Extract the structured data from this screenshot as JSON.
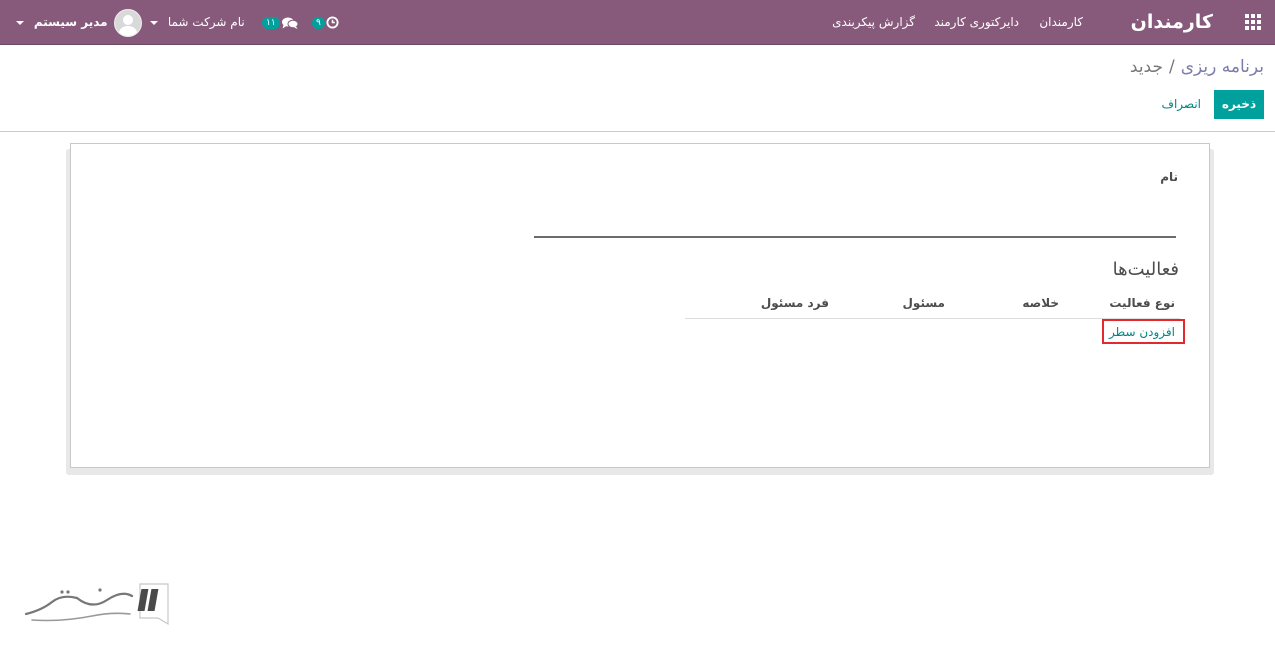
{
  "navbar": {
    "brand": "کارمندان",
    "menu": [
      "کارمندان",
      "دایرکتوری کارمند",
      "گزارش",
      "پیکربندی"
    ],
    "activity_badge": "۹",
    "messages_badge": "۱۱",
    "company": "نام شرکت شما",
    "user": "مدیر سیستم"
  },
  "breadcrumb": {
    "parent": "برنامه ریزی",
    "separator": "/",
    "current": "جدید"
  },
  "buttons": {
    "save": "ذخیره",
    "discard": "انصراف"
  },
  "form": {
    "name_label": "نام",
    "section_title": "فعالیت‌ها",
    "columns": [
      "نوع فعالیت",
      "خلاصه",
      "مسئول",
      "فرد مسئول"
    ],
    "add_line": "افزودن سطر"
  }
}
